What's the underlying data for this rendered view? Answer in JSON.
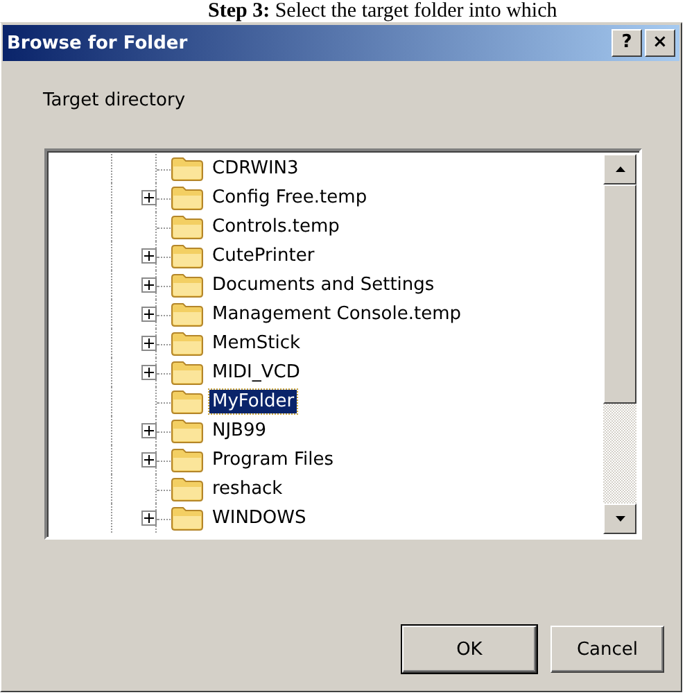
{
  "caption": "**Step 3:** Select the target folder into which",
  "window": {
    "title": "Browse for Folder",
    "title_buttons": [
      "?",
      "×"
    ]
  },
  "prompt": "Target directory",
  "tree": {
    "items": [
      {
        "label": "CDRWIN3",
        "expandable": false,
        "selected": false
      },
      {
        "label": "Config Free.temp",
        "expandable": true,
        "selected": false
      },
      {
        "label": "Controls.temp",
        "expandable": false,
        "selected": false
      },
      {
        "label": "CutePrinter",
        "expandable": true,
        "selected": false
      },
      {
        "label": "Documents and Settings",
        "expandable": true,
        "selected": false
      },
      {
        "label": "Management Console.temp",
        "expandable": true,
        "selected": false
      },
      {
        "label": "MemStick",
        "expandable": true,
        "selected": false
      },
      {
        "label": "MIDI_VCD",
        "expandable": true,
        "selected": false
      },
      {
        "label": "MyFolder",
        "expandable": false,
        "selected": true
      },
      {
        "label": "NJB99",
        "expandable": true,
        "selected": false
      },
      {
        "label": "Program Files",
        "expandable": true,
        "selected": false
      },
      {
        "label": "reshack",
        "expandable": false,
        "selected": false
      },
      {
        "label": "WINDOWS",
        "expandable": true,
        "selected": false
      }
    ]
  },
  "buttons": [
    {
      "label": "OK",
      "default": true
    },
    {
      "label": "Cancel",
      "default": false
    }
  ]
}
